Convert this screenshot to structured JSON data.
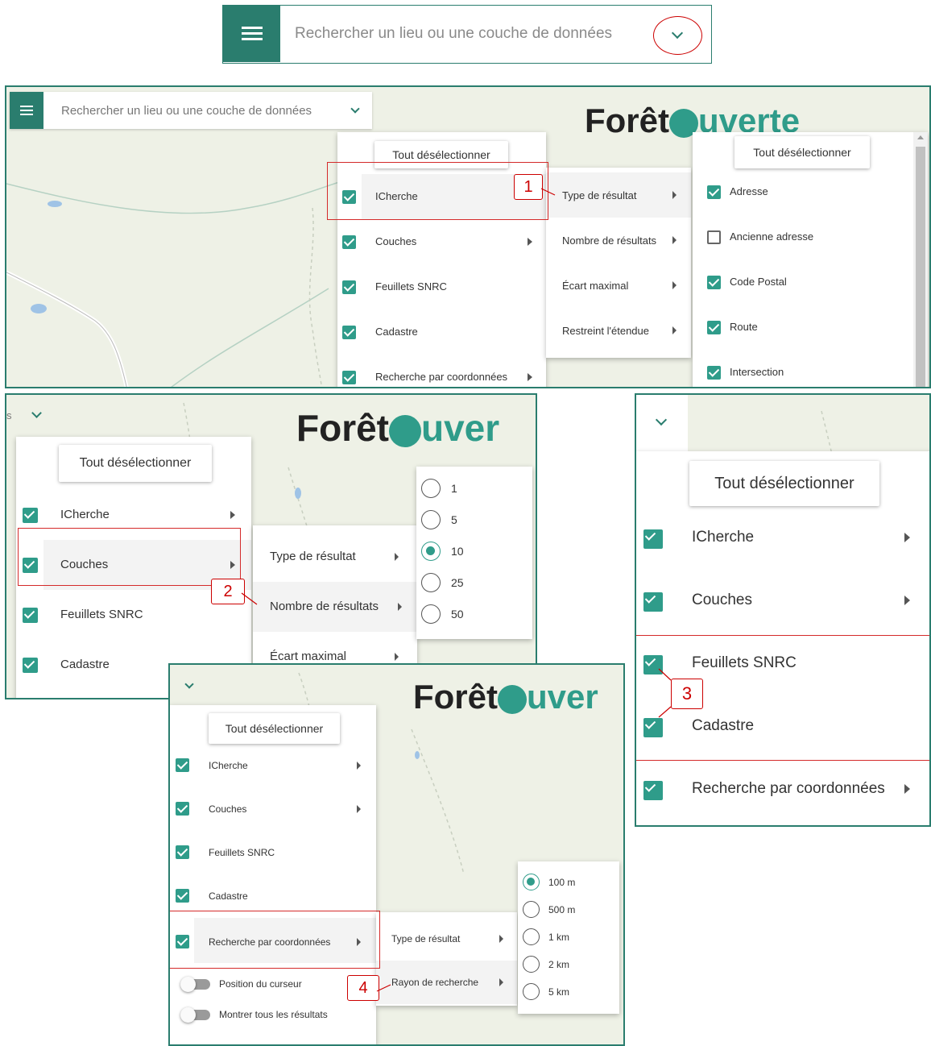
{
  "search_bar": {
    "placeholder": "Rechercher un lieu ou une couche de données"
  },
  "logo": {
    "foret": "Forêt",
    "ouverte": "uverte",
    "ouver": "uver"
  },
  "deselect_all": "Tout désélectionner",
  "menu": {
    "icherche": "ICherche",
    "couches": "Couches",
    "feuillets": "Feuillets SNRC",
    "cadastre": "Cadastre",
    "coordonnees": "Recherche par coordonnées"
  },
  "submenu": {
    "type_resultat": "Type de résultat",
    "nombre_resultats": "Nombre de résultats",
    "ecart_maximal": "Écart maximal",
    "restreint": "Restreint l'étendue",
    "rayon": "Rayon de recherche"
  },
  "result_types": [
    {
      "label": "Adresse",
      "checked": true
    },
    {
      "label": "Ancienne adresse",
      "checked": false
    },
    {
      "label": "Code Postal",
      "checked": true
    },
    {
      "label": "Route",
      "checked": true
    },
    {
      "label": "Intersection",
      "checked": true
    }
  ],
  "result_counts": {
    "options": [
      "1",
      "5",
      "10",
      "25",
      "50"
    ],
    "selected": "10"
  },
  "radius": {
    "options": [
      "100 m",
      "500 m",
      "1 km",
      "2 km",
      "5 km"
    ],
    "selected": "100 m"
  },
  "toggles": {
    "cursor_position": "Position du curseur",
    "show_all": "Montrer tous les résultats"
  },
  "callouts": [
    "1",
    "2",
    "3",
    "4"
  ],
  "colors": {
    "accent": "#2a7d6e",
    "checkbox": "#2f9c8a",
    "annotation": "#d42a2a"
  }
}
